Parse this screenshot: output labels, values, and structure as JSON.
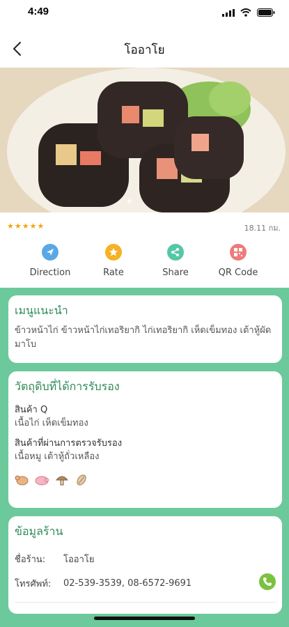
{
  "status": {
    "time": "4:49"
  },
  "nav": {
    "title": "โออาโย"
  },
  "rating": {
    "stars": 5,
    "distance": "18.11 กม."
  },
  "actions": [
    {
      "label": "Direction",
      "color": "#5aa7e6",
      "icon": "navigation-icon"
    },
    {
      "label": "Rate",
      "color": "#f5b225",
      "icon": "star-icon"
    },
    {
      "label": "Share",
      "color": "#55c7a6",
      "icon": "share-icon"
    },
    {
      "label": "QR Code",
      "color": "#ef7a7a",
      "icon": "qr-code-icon"
    }
  ],
  "menu_card": {
    "title": "เมนูแนะนำ",
    "text": "ข้าวหน้าไก่ ข้าวหน้าไก่เทอริยากิ ไก่เทอริยากิ เห็ดเข็มทอง เต้าหู้ผัดมาโบ"
  },
  "ingredients_card": {
    "title": "วัตถุดิบที่ได้การรับรอง",
    "group1_title": "สินค้า Q",
    "group1_text": "เนื้อไก่ เห็ดเข็มทอง",
    "group2_title": "สินค้าที่ผ่านการตรวจรับรอง",
    "group2_text": "เนื้อหมู เต้าหู้ถั่วเหลือง",
    "icons": [
      "chicken-icon",
      "pig-icon",
      "mushroom-icon",
      "bean-icon"
    ]
  },
  "shop_card": {
    "title": "ข้อมูลร้าน",
    "name_label": "ชื่อร้าน:",
    "name_value": "โออาโย",
    "phone_label": "โทรศัพท์:",
    "phone_value": "02-539-3539, 08-6572-9691"
  }
}
